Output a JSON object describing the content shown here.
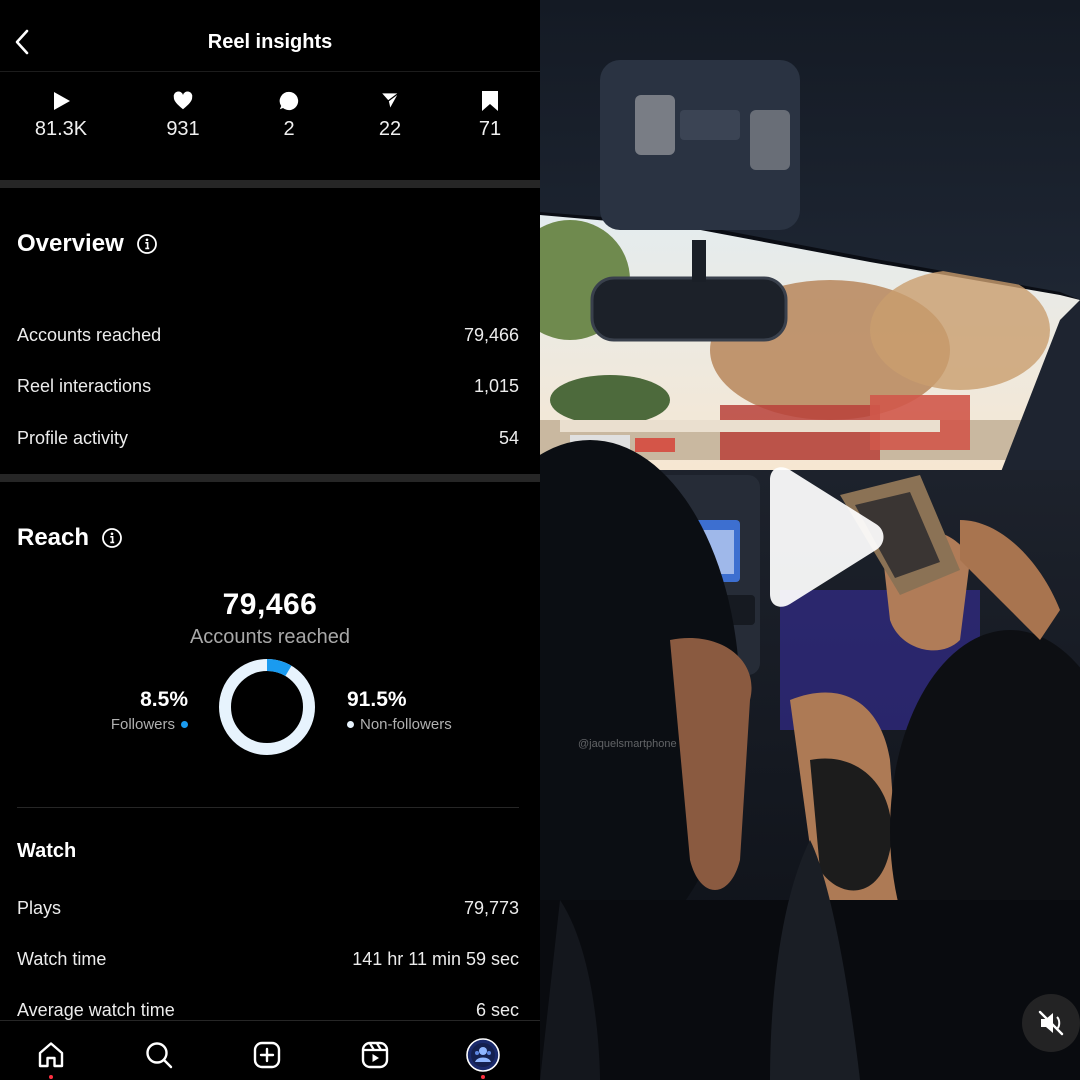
{
  "header": {
    "title": "Reel insights"
  },
  "stats": [
    {
      "icon": "play-icon",
      "value": "81.3K"
    },
    {
      "icon": "heart-icon",
      "value": "931"
    },
    {
      "icon": "comment-icon",
      "value": "2"
    },
    {
      "icon": "share-icon",
      "value": "22"
    },
    {
      "icon": "bookmark-icon",
      "value": "71"
    }
  ],
  "overview": {
    "title": "Overview",
    "rows": [
      {
        "label": "Accounts reached",
        "value": "79,466"
      },
      {
        "label": "Reel interactions",
        "value": "1,015"
      },
      {
        "label": "Profile activity",
        "value": "54"
      }
    ]
  },
  "reach": {
    "title": "Reach",
    "total": "79,466",
    "total_label": "Accounts reached",
    "followers_pct": "8.5%",
    "followers_label": "Followers",
    "followers_fraction": 0.085,
    "nonfollowers_pct": "91.5%",
    "nonfollowers_label": "Non-followers",
    "followers_color": "#1a9bf0",
    "nonfollowers_color": "#e7f3fd"
  },
  "watch": {
    "title": "Watch",
    "rows": [
      {
        "label": "Plays",
        "value": "79,773"
      },
      {
        "label": "Watch time",
        "value": "141 hr 11 min 59 sec"
      },
      {
        "label": "Average watch time",
        "value": "6 sec"
      }
    ]
  },
  "nav": [
    "home-icon",
    "search-icon",
    "create-icon",
    "reels-icon",
    "profile-avatar"
  ],
  "video": {
    "watermark": "@jaquelsmartphone",
    "play_icon": "play-icon",
    "mute_icon": "muted-speaker-icon"
  }
}
